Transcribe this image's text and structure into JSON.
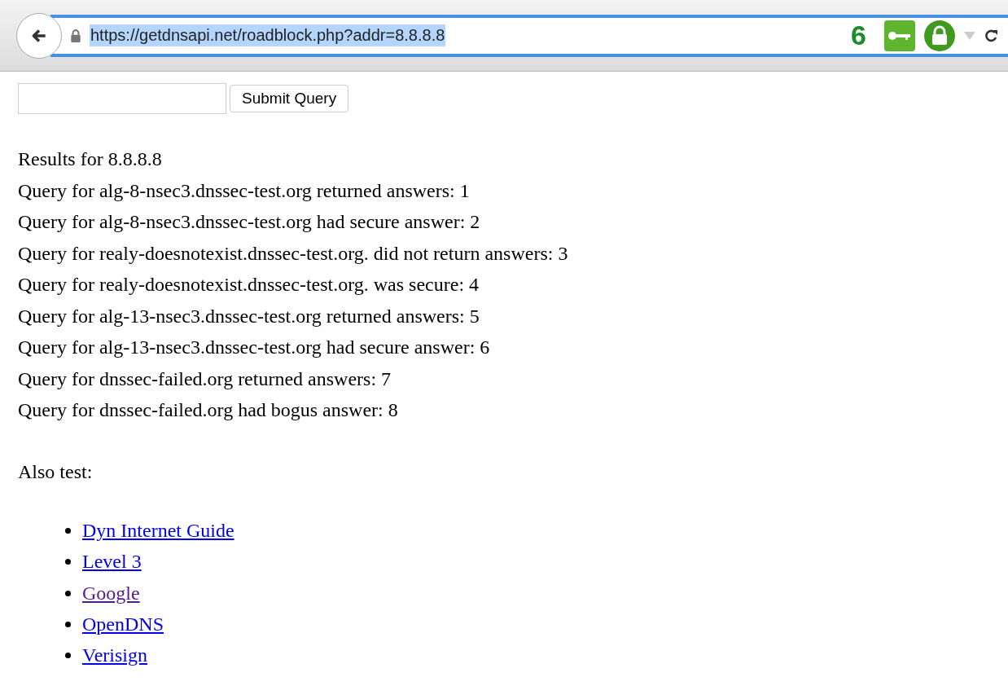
{
  "toolbar": {
    "url": "https://getdnsapi.net/roadblock.php?addr=8.8.8.8",
    "url_selected": true,
    "badge_count": "6"
  },
  "form": {
    "button": "Submit Query"
  },
  "results": [
    "Results for 8.8.8.8",
    "Query for alg-8-nsec3.dnssec-test.org returned answers: 1",
    "Query for alg-8-nsec3.dnssec-test.org had secure answer: 2",
    "Query for realy-doesnotexist.dnssec-test.org. did not return answers: 3",
    "Query for realy-doesnotexist.dnssec-test.org. was secure: 4",
    "Query for alg-13-nsec3.dnssec-test.org returned answers: 5",
    "Query for alg-13-nsec3.dnssec-test.org had secure answer: 6",
    "Query for dnssec-failed.org returned answers: 7",
    "Query for dnssec-failed.org had bogus answer: 8"
  ],
  "also_test": "Also test:",
  "links": [
    {
      "label": "Dyn Internet Guide",
      "visited": false
    },
    {
      "label": "Level 3",
      "visited": false
    },
    {
      "label": "Google",
      "visited": true
    },
    {
      "label": "OpenDNS",
      "visited": false
    },
    {
      "label": "Verisign",
      "visited": false
    }
  ]
}
